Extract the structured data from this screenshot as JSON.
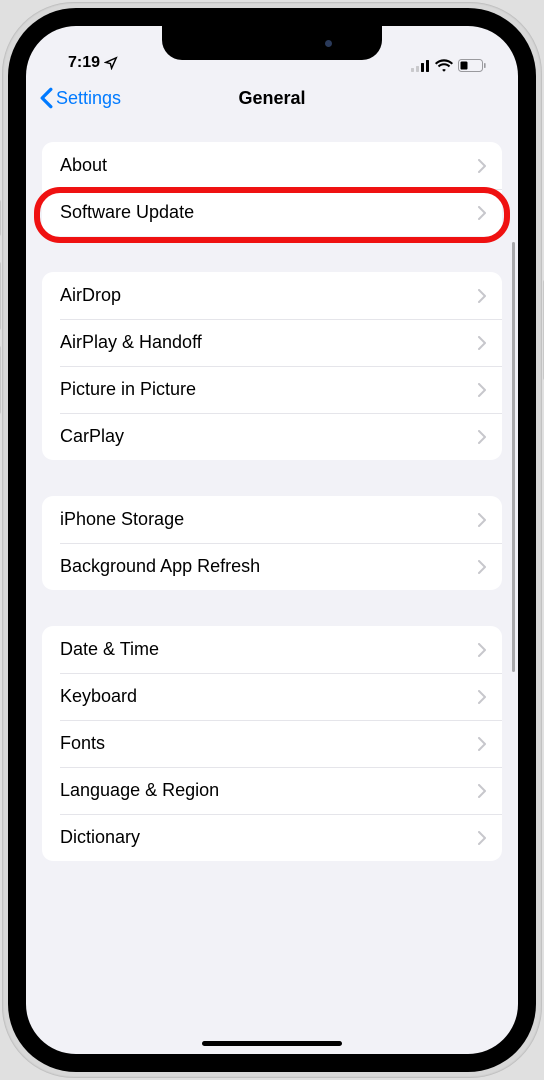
{
  "status": {
    "time": "7:19",
    "location_icon": "location-arrow"
  },
  "nav": {
    "back_label": "Settings",
    "title": "General"
  },
  "groups": [
    {
      "items": [
        {
          "label": "About",
          "key": "about"
        },
        {
          "label": "Software Update",
          "key": "software-update",
          "highlighted": true
        }
      ]
    },
    {
      "items": [
        {
          "label": "AirDrop",
          "key": "airdrop"
        },
        {
          "label": "AirPlay & Handoff",
          "key": "airplay-handoff"
        },
        {
          "label": "Picture in Picture",
          "key": "picture-in-picture"
        },
        {
          "label": "CarPlay",
          "key": "carplay"
        }
      ]
    },
    {
      "items": [
        {
          "label": "iPhone Storage",
          "key": "iphone-storage"
        },
        {
          "label": "Background App Refresh",
          "key": "background-app-refresh"
        }
      ]
    },
    {
      "items": [
        {
          "label": "Date & Time",
          "key": "date-time"
        },
        {
          "label": "Keyboard",
          "key": "keyboard"
        },
        {
          "label": "Fonts",
          "key": "fonts"
        },
        {
          "label": "Language & Region",
          "key": "language-region"
        },
        {
          "label": "Dictionary",
          "key": "dictionary"
        }
      ]
    }
  ]
}
